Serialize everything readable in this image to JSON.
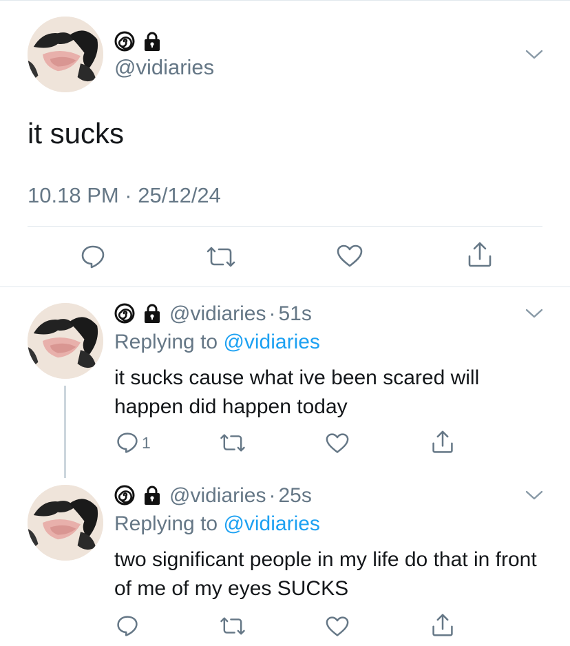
{
  "main_tweet": {
    "handle": "@vidiaries",
    "text": "it sucks",
    "timestamp": "10.18 PM · 25/12/24",
    "badges": [
      "spiral-emoji",
      "lock-icon"
    ]
  },
  "replies": [
    {
      "handle": "@vidiaries",
      "separator": "·",
      "time": "51s",
      "replying_prefix": "Replying to ",
      "replying_to": "@vidiaries",
      "text": "it sucks cause what ive been scared will happen did happen today",
      "reply_count": "1"
    },
    {
      "handle": "@vidiaries",
      "separator": "·",
      "time": "25s",
      "replying_prefix": "Replying to ",
      "replying_to": "@vidiaries",
      "text": "two significant people in my life do that in front of me of my eyes SUCKS",
      "reply_count": ""
    }
  ],
  "colors": {
    "secondary_text": "#657786",
    "link": "#1da1f2",
    "icon": "#657786",
    "divider": "#e1e8ed"
  }
}
